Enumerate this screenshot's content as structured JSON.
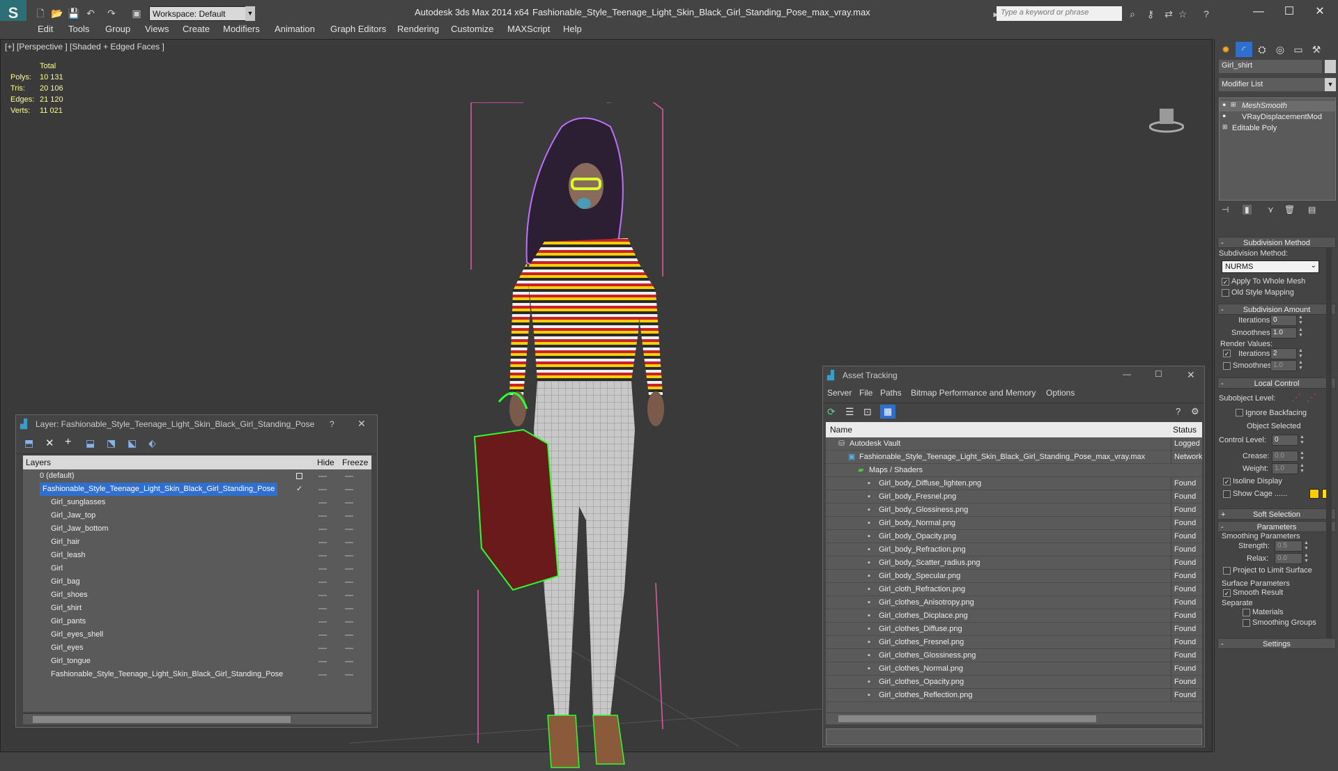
{
  "app": {
    "title": "Autodesk 3ds Max  2014 x64",
    "file": "Fashionable_Style_Teenage_Light_Skin_Black_Girl_Standing_Pose_max_vray.max",
    "logo": "S",
    "workspace": "Workspace: Default",
    "search_placeholder": "Type a keyword or phrase"
  },
  "menu": [
    "Edit",
    "Tools",
    "Group",
    "Views",
    "Create",
    "Modifiers",
    "Animation",
    "Graph Editors",
    "Rendering",
    "Customize",
    "MAXScript",
    "Help"
  ],
  "viewport": {
    "label": "[+] [Perspective ] [Shaded + Edged Faces ]",
    "stats": {
      "header": "Total",
      "rows": [
        {
          "k": "Polys:",
          "v": "10 131"
        },
        {
          "k": "Tris:",
          "v": "20 106"
        },
        {
          "k": "Edges:",
          "v": "21 120"
        },
        {
          "k": "Verts:",
          "v": "11 021"
        }
      ]
    }
  },
  "layer_window": {
    "title": "Layer: Fashionable_Style_Teenage_Light_Skin_Black_Girl_Standing_Pose",
    "help": "?",
    "close": "✕",
    "columns": {
      "layers": "Layers",
      "hide": "Hide",
      "freeze": "Freeze"
    },
    "rows": [
      "0 (default)",
      "Fashionable_Style_Teenage_Light_Skin_Black_Girl_Standing_Pose",
      "Girl_sunglasses",
      "Girl_Jaw_top",
      "Girl_Jaw_bottom",
      "Girl_hair",
      "Girl_leash",
      "Girl",
      "Girl_bag",
      "Girl_shoes",
      "Girl_shirt",
      "Girl_pants",
      "Girl_eyes_shell",
      "Girl_eyes",
      "Girl_tongue",
      "Fashionable_Style_Teenage_Light_Skin_Black_Girl_Standing_Pose"
    ]
  },
  "asset_window": {
    "title": "Asset Tracking",
    "menu": [
      "Server",
      "File",
      "Paths",
      "Bitmap Performance and Memory",
      "Options"
    ],
    "columns": {
      "name": "Name",
      "status": "Status"
    },
    "rows": [
      {
        "name": "Autodesk Vault",
        "status": "Logged Out",
        "indent": 1
      },
      {
        "name": "Fashionable_Style_Teenage_Light_Skin_Black_Girl_Standing_Pose_max_vray.max",
        "status": "Network",
        "indent": 2
      },
      {
        "name": "Maps / Shaders",
        "status": "",
        "indent": 3
      },
      {
        "name": "Girl_body_Diffuse_lighten.png",
        "status": "Found",
        "indent": 4
      },
      {
        "name": "Girl_body_Fresnel.png",
        "status": "Found",
        "indent": 4
      },
      {
        "name": "Girl_body_Glossiness.png",
        "status": "Found",
        "indent": 4
      },
      {
        "name": "Girl_body_Normal.png",
        "status": "Found",
        "indent": 4
      },
      {
        "name": "Girl_body_Opacity.png",
        "status": "Found",
        "indent": 4
      },
      {
        "name": "Girl_body_Refraction.png",
        "status": "Found",
        "indent": 4
      },
      {
        "name": "Girl_body_Scatter_radius.png",
        "status": "Found",
        "indent": 4
      },
      {
        "name": "Girl_body_Specular.png",
        "status": "Found",
        "indent": 4
      },
      {
        "name": "Girl_cloth_Refraction.png",
        "status": "Found",
        "indent": 4
      },
      {
        "name": "Girl_clothes_Anisotropy.png",
        "status": "Found",
        "indent": 4
      },
      {
        "name": "Girl_clothes_Dicplace.png",
        "status": "Found",
        "indent": 4
      },
      {
        "name": "Girl_clothes_Diffuse.png",
        "status": "Found",
        "indent": 4
      },
      {
        "name": "Girl_clothes_Fresnel.png",
        "status": "Found",
        "indent": 4
      },
      {
        "name": "Girl_clothes_Glossiness.png",
        "status": "Found",
        "indent": 4
      },
      {
        "name": "Girl_clothes_Normal.png",
        "status": "Found",
        "indent": 4
      },
      {
        "name": "Girl_clothes_Opacity.png",
        "status": "Found",
        "indent": 4
      },
      {
        "name": "Girl_clothes_Reflection.png",
        "status": "Found",
        "indent": 4
      }
    ]
  },
  "command_panel": {
    "object_name": "Girl_shirt",
    "modifier_list": "Modifier List",
    "stack": [
      "MeshSmooth",
      "VRayDisplacementMod",
      "Editable Poly"
    ],
    "subdivision_method": {
      "header": "Subdivision Method",
      "label": "Subdivision Method:",
      "value": "NURMS",
      "apply_whole": "Apply To Whole Mesh",
      "old_style": "Old Style Mapping"
    },
    "subdivision_amount": {
      "header": "Subdivision Amount",
      "iterations_label": "Iterations:",
      "iterations": "0",
      "smoothness_label": "Smoothness:",
      "smoothness": "1.0",
      "render_values": "Render Values:",
      "r_iterations_label": "Iterations:",
      "r_iterations": "2",
      "r_smoothness_label": "Smoothness:",
      "r_smoothness": "1.0"
    },
    "local_control": {
      "header": "Local Control",
      "sublevel": "Subobject Level:",
      "ignore_backfacing": "Ignore Backfacing",
      "object_selected": "Object Selected",
      "control_level": "Control Level:",
      "control_value": "0",
      "crease": "Crease:",
      "crease_value": "0.0",
      "weight": "Weight:",
      "weight_value": "1.0",
      "isoline": "Isoline Display",
      "show_cage": "Show Cage ......"
    },
    "soft_selection": "Soft Selection",
    "parameters": {
      "header": "Parameters",
      "smoothing": "Smoothing Parameters",
      "strength": "Strength:",
      "strength_value": "0.5",
      "relax": "Relax:",
      "relax_value": "0.0",
      "project": "Project to Limit Surface",
      "surface": "Surface Parameters",
      "smooth_result": "Smooth Result",
      "separate": "Separate",
      "materials": "Materials",
      "smoothing_groups": "Smoothing Groups"
    },
    "settings": "Settings"
  },
  "colors": {
    "cage1": "#ffcc00",
    "cage2": "#ffdd00",
    "selection": "#2f6fd0"
  }
}
